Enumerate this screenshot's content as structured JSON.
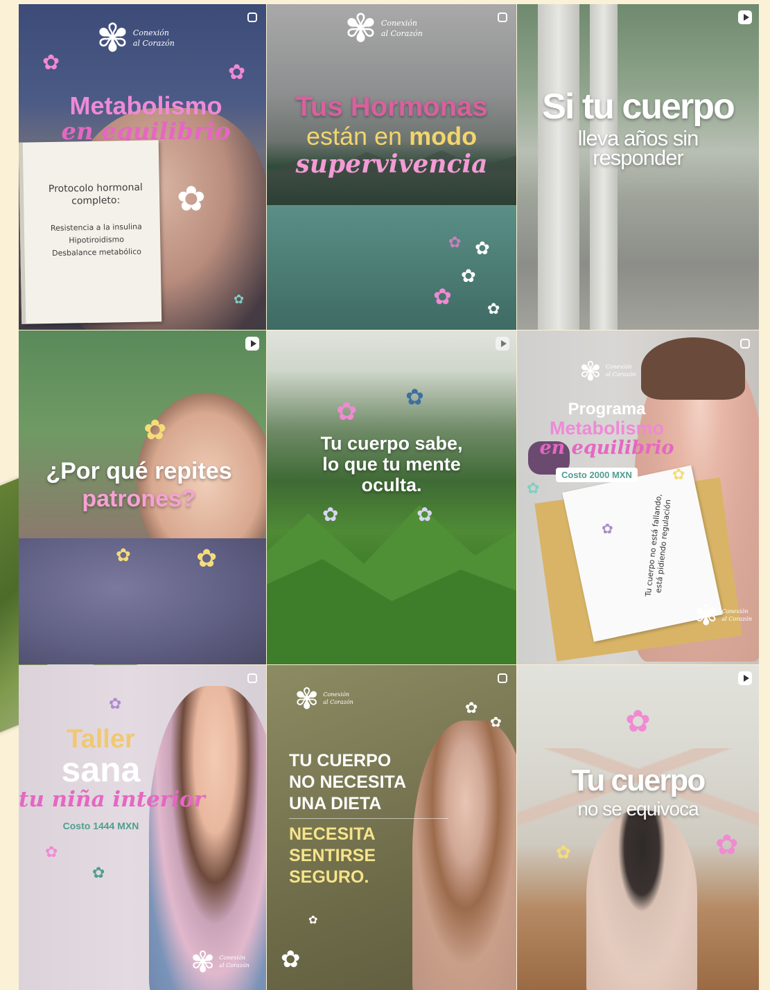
{
  "brand": {
    "logo_text": "Conexión\nal Corazón"
  },
  "colors": {
    "pink": "#e76ec0",
    "pink_light": "#f08ad3",
    "teal": "#4f9e8f",
    "cream": "#fbf1d6",
    "yellow": "#f7e48a",
    "gold": "#f1c872"
  },
  "icons": {
    "flower": "✿",
    "logo_flower": "✾",
    "carousel": "carousel-icon",
    "reel": "reel-icon"
  },
  "tiles": [
    {
      "title_1": "Metabolismo",
      "title_2": "en equilibrio",
      "notebook": {
        "heading_1": "Protocolo hormonal",
        "heading_2": "completo:",
        "item_1": "Resistencia a la insulina",
        "item_2": "Hipotiroidismo",
        "item_3": "Desbalance metabólico"
      }
    },
    {
      "title_1": "Tus Hormonas",
      "title_2a": "están en",
      "title_2b": "modo",
      "title_3": "supervivencia"
    },
    {
      "title_1": "Si tu cuerpo",
      "title_2": "lleva años sin",
      "title_3": "responder"
    },
    {
      "title_1": "¿Por qué repites",
      "title_2": "patrones?"
    },
    {
      "title_1": "Tu cuerpo sabe,",
      "title_2": "lo que tu mente",
      "title_3": "oculta."
    },
    {
      "title_1": "Programa",
      "title_2": "Metabolismo",
      "title_3": "en equilibrio",
      "price": "Costo  2000 MXN",
      "card_text": "Tu cuerpo no está fallando, está pidiendo regulación"
    },
    {
      "title_1": "Taller",
      "title_2": "sana",
      "title_3": "tu niña interior",
      "price": "Costo  1444 MXN"
    },
    {
      "line_1": "TU CUERPO",
      "line_2": "NO NECESITA",
      "line_3": "UNA DIETA",
      "line_4": "NECESITA",
      "line_5": "SENTIRSE",
      "line_6": "SEGURO."
    },
    {
      "title_1": "Tu cuerpo",
      "title_2": "no se equivoca"
    }
  ]
}
